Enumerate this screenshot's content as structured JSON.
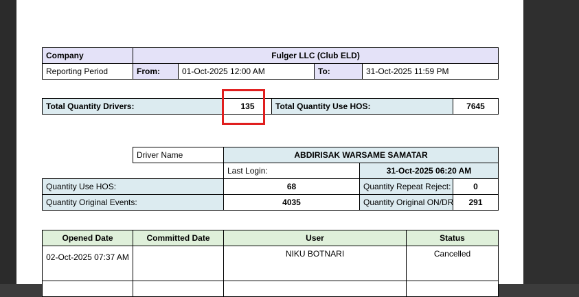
{
  "summary": {
    "company_label": "Company",
    "company_name": "Fulger LLC (Club ELD)",
    "reporting_period_label": "Reporting Period",
    "from_label": "From:",
    "from_value": "01-Oct-2025 12:00 AM",
    "to_label": "To:",
    "to_value": "31-Oct-2025 11:59 PM"
  },
  "totals": {
    "drivers_label": "Total Quantity Drivers:",
    "drivers_value": "135",
    "use_hos_label": "Total Quantity Use HOS:",
    "use_hos_value": "7645"
  },
  "driver": {
    "name_label": "Driver Name",
    "name_value": "ABDIRISAK WARSAME SAMATAR",
    "last_login_label": "Last Login:",
    "last_login_value": "31-Oct-2025 06:20 AM",
    "use_hos_label": "Quantity Use HOS:",
    "use_hos_value": "68",
    "repeat_reject_label": "Quantity Repeat Reject:",
    "repeat_reject_value": "0",
    "original_events_label": "Quantity Original Events:",
    "original_events_value": "4035",
    "original_ondr_label": "Quantity Original ON/DR Events:",
    "original_ondr_value": "291"
  },
  "events_table": {
    "headers": [
      "Opened Date",
      "Committed Date",
      "User",
      "Status"
    ],
    "rows": [
      {
        "opened": "02-Oct-2025 07:37 AM",
        "committed": "",
        "user": "NIKU BOTNARI",
        "status": "Cancelled"
      }
    ]
  },
  "colors": {
    "header_purple": "#e4e2f8",
    "header_blue": "#dcebf0",
    "header_green": "#dff0da",
    "highlight_red": "#e01e1e"
  }
}
